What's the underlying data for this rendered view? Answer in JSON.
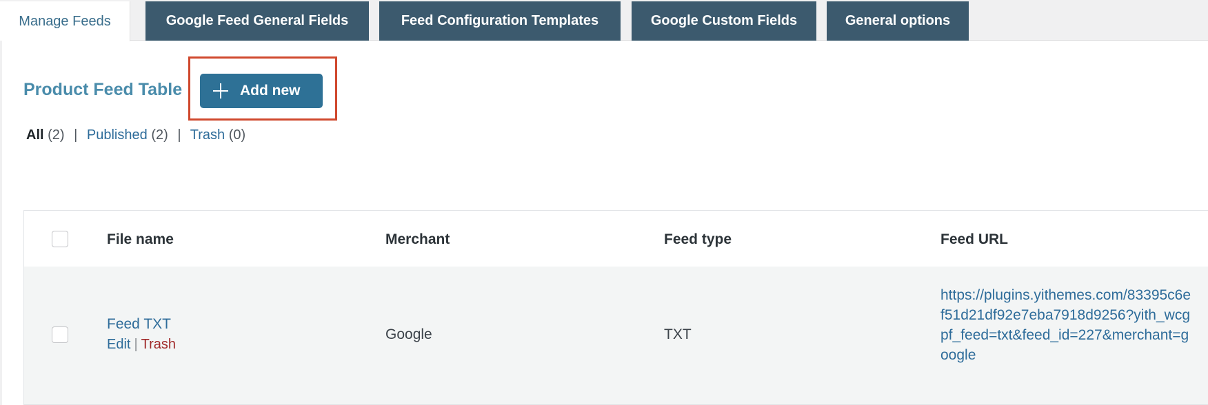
{
  "tabs": [
    {
      "label": "Manage Feeds",
      "active": true
    },
    {
      "label": "Google Feed General Fields",
      "active": false
    },
    {
      "label": "Feed Configuration Templates",
      "active": false
    },
    {
      "label": "Google Custom Fields",
      "active": false
    },
    {
      "label": "General options",
      "active": false
    }
  ],
  "header": {
    "title": "Product Feed Table",
    "add_new_label": "Add new"
  },
  "filters": {
    "all_label": "All",
    "all_count": "(2)",
    "published_label": "Published",
    "published_count": "(2)",
    "trash_label": "Trash",
    "trash_count": "(0)",
    "separator": "|"
  },
  "table": {
    "columns": [
      "File name",
      "Merchant",
      "Feed type",
      "Feed URL"
    ],
    "rows": [
      {
        "file_name": "Feed TXT",
        "edit_label": "Edit",
        "trash_label": "Trash",
        "action_separator": "|",
        "merchant": "Google",
        "feed_type": "TXT",
        "feed_url": "https://plugins.yithemes.com/83395c6ef51d21df92e7eba7918d9256?yith_wcgpf_feed=txt&feed_id=227&merchant=google"
      }
    ]
  },
  "colors": {
    "tab_bg": "#3c5a6e",
    "button_bg": "#2e7196",
    "highlight_border": "#d0482d",
    "link": "#2e6c9a",
    "trash_link": "#a02a2a"
  }
}
